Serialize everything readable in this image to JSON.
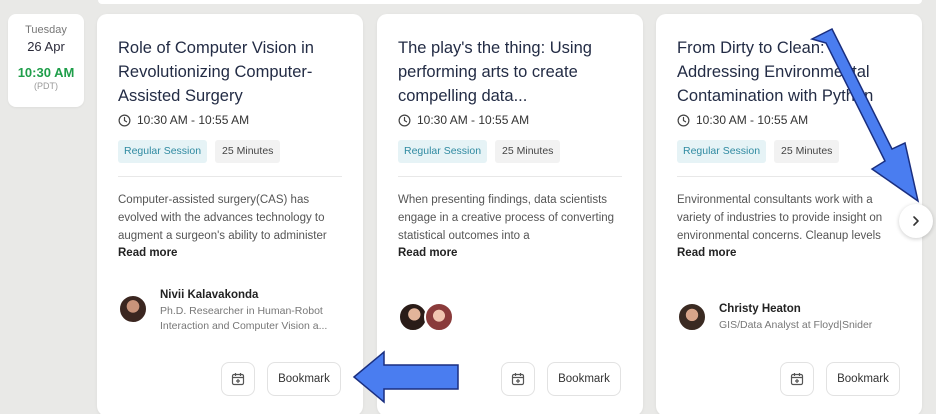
{
  "date": {
    "weekday": "Tuesday",
    "day": "26 Apr",
    "time": "10:30 AM",
    "timezone": "(PDT)"
  },
  "cards": [
    {
      "title": "Role of Computer Vision in Revolutionizing Computer-Assisted Surgery",
      "time_range": "10:30 AM - 10:55 AM",
      "session_tag": "Regular Session",
      "duration_tag": "25 Minutes",
      "description": "Computer-assisted surgery(CAS) has evolved with the advances technology to augment a surgeon's ability to administer",
      "read_more": "Read more",
      "speaker_name": "Nivii Kalavakonda",
      "speaker_role": "Ph.D. Researcher in Human-Robot Interaction and Computer Vision a...",
      "bookmark_label": "Bookmark"
    },
    {
      "title": "The play's the thing: Using performing arts to create compelling data...",
      "time_range": "10:30 AM - 10:55 AM",
      "session_tag": "Regular Session",
      "duration_tag": "25 Minutes",
      "description": "When presenting findings, data scientists engage in a creative process of converting statistical outcomes into a",
      "read_more": "Read more",
      "bookmark_label": "Bookmark"
    },
    {
      "title": "From Dirty to Clean: Addressing Environmental Contamination with Python",
      "time_range": "10:30 AM - 10:55 AM",
      "session_tag": "Regular Session",
      "duration_tag": "25 Minutes",
      "description": "Environmental consultants work with a variety of industries to provide insight on environmental concerns. Cleanup levels",
      "read_more": "Read more",
      "speaker_name": "Christy Heaton",
      "speaker_role": "GIS/Data Analyst at Floyd|Snider",
      "bookmark_label": "Bookmark"
    }
  ],
  "colors": {
    "accent_green": "#1f9e4a",
    "tag_blue": "#2f8aa1",
    "overlay_arrow": "#4a7df0"
  },
  "icons": [
    "clock-icon",
    "calendar-add-icon",
    "chevron-right-icon",
    "arrow-left-overlay-icon",
    "arrow-down-right-overlay-icon"
  ]
}
